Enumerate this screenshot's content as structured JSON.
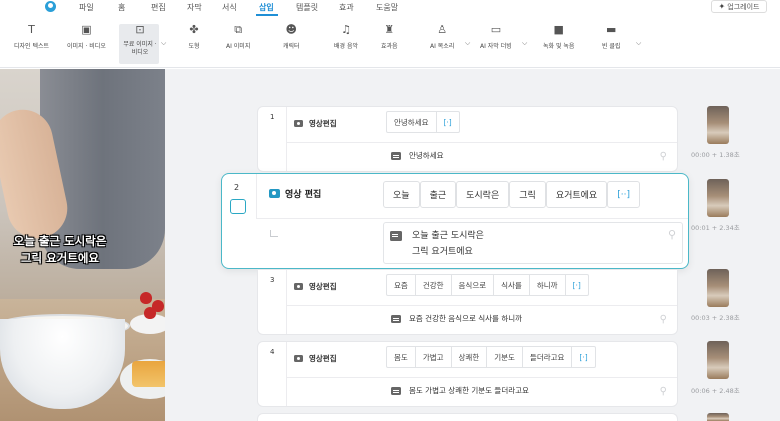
{
  "menu": {
    "tabs": [
      "파일",
      "홈",
      "편집",
      "자막",
      "서식",
      "삽입",
      "템플릿",
      "효과",
      "도움말"
    ],
    "active": "삽입",
    "upgrade_label": "업그레이드"
  },
  "ribbon": {
    "items": [
      {
        "icon": "design-text-icon",
        "label": "디자인 텍스트"
      },
      {
        "icon": "image-video-icon",
        "label": "이미지 · 비디오"
      },
      {
        "icon": "free-image-icon",
        "label": "무료 이미지 · 비디오"
      },
      {
        "icon": "shape-icon",
        "label": "도형"
      },
      {
        "icon": "ai-image-icon",
        "label": "AI 이미지"
      },
      {
        "icon": "character-icon",
        "label": "캐릭터"
      },
      {
        "icon": "music-icon",
        "label": "배경 음악"
      },
      {
        "icon": "sound-effect-icon",
        "label": "효과음"
      },
      {
        "icon": "ai-voice-icon",
        "label": "AI 목소리"
      },
      {
        "icon": "ai-dubbing-icon",
        "label": "AI 자막 더빙"
      },
      {
        "icon": "record-icon",
        "label": "녹화 및 녹음"
      },
      {
        "icon": "blank-clip-icon",
        "label": "빈 클립"
      }
    ]
  },
  "preview": {
    "caption_line1": "오늘 출근 도시락은",
    "caption_line2": "그릭 요거트에요"
  },
  "clips": [
    {
      "num": "1",
      "label": "영상편집",
      "words": [
        "안녕하세요"
      ],
      "more": "[·]",
      "subtitle": "안녕하세요",
      "time": "00:00 + 1.38초"
    },
    {
      "num": "2",
      "label": "영상 편집",
      "words": [
        "오늘",
        "출근",
        "도시락은",
        "그릭",
        "요거트에요"
      ],
      "more": "[··]",
      "subtitle_line1": "오늘 출근 도시락은",
      "subtitle_line2": "그릭 요거트에요",
      "time": "00:01 + 2.34초"
    },
    {
      "num": "3",
      "label": "영상편집",
      "words": [
        "요즘",
        "건강한",
        "음식으로",
        "식사를",
        "하니까"
      ],
      "more": "[·]",
      "subtitle": "요즘 건강한 음식으로 식사를 하니까",
      "time": "00:03 + 2.38초"
    },
    {
      "num": "4",
      "label": "영상편집",
      "words": [
        "몸도",
        "가볍고",
        "상쾌한",
        "기분도",
        "들더라고요"
      ],
      "more": "[·]",
      "subtitle": "몸도 가볍고 상쾌한 기분도 들더라고요",
      "time": "00:06 + 2.48초"
    }
  ],
  "colors": {
    "accent": "#1f8fd6",
    "focus_border": "#4bb8c8",
    "bracket": "#2a9fd8"
  }
}
